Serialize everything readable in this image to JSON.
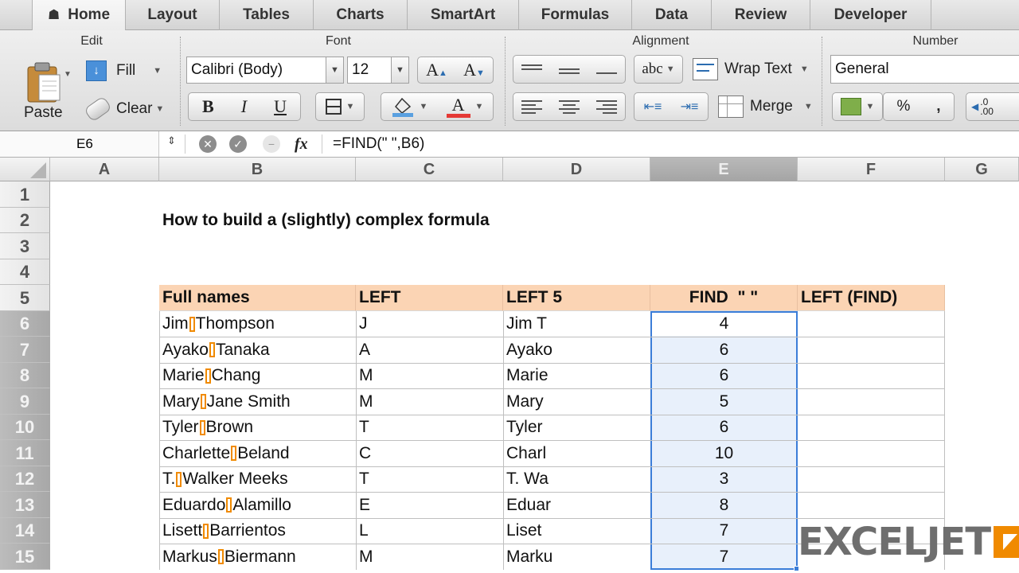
{
  "tabs": [
    {
      "label": "Home",
      "active": true
    },
    {
      "label": "Layout"
    },
    {
      "label": "Tables"
    },
    {
      "label": "Charts"
    },
    {
      "label": "SmartArt"
    },
    {
      "label": "Formulas"
    },
    {
      "label": "Data"
    },
    {
      "label": "Review"
    },
    {
      "label": "Developer"
    }
  ],
  "ribbon": {
    "groups": {
      "edit": "Edit",
      "font": "Font",
      "alignment": "Alignment",
      "number": "Number"
    },
    "paste_label": "Paste",
    "fill_label": "Fill",
    "clear_label": "Clear",
    "font_name": "Calibri (Body)",
    "font_size": "12",
    "bold": "B",
    "italic": "I",
    "underline": "U",
    "grow_font": "A",
    "shrink_font": "A",
    "font_color": "A",
    "abc_label": "abc",
    "wrap_text_label": "Wrap Text",
    "merge_label": "Merge",
    "number_format": "General",
    "percent": "%",
    "comma": ",",
    "decimal": ".0",
    "decimal_2": ".00",
    "font_color_accent": "#e53935"
  },
  "formula_bar": {
    "cell_ref": "E6",
    "formula": "=FIND(\" \",B6)",
    "fx": "fx"
  },
  "sheet": {
    "columns": [
      "A",
      "B",
      "C",
      "D",
      "E",
      "F",
      "G"
    ],
    "rows": [
      "1",
      "2",
      "3",
      "4",
      "5",
      "6",
      "7",
      "8",
      "9",
      "10",
      "11",
      "12",
      "13",
      "14",
      "15"
    ],
    "title": "How to build a (slightly) complex formula",
    "headers": [
      "Full names",
      "LEFT",
      "LEFT 5",
      "FIND  \" \"",
      "LEFT (FIND)"
    ],
    "data": [
      {
        "first": "Jim",
        "rest": "Thompson",
        "left": "J",
        "left5": "Jim T",
        "find": "4"
      },
      {
        "first": "Ayako",
        "rest": "Tanaka",
        "left": "A",
        "left5": "Ayako",
        "find": "6"
      },
      {
        "first": "Marie",
        "rest": "Chang",
        "left": "M",
        "left5": "Marie",
        "find": "6"
      },
      {
        "first": "Mary",
        "rest": "Jane Smith",
        "left": "M",
        "left5": "Mary",
        "find": "5"
      },
      {
        "first": "Tyler",
        "rest": "Brown",
        "left": "T",
        "left5": "Tyler",
        "find": "6"
      },
      {
        "first": "Charlette",
        "rest": "Beland",
        "left": "C",
        "left5": "Charl",
        "find": "10"
      },
      {
        "first": "T.",
        "rest": "Walker Meeks",
        "left": "T",
        "left5": "T. Wa",
        "find": "3"
      },
      {
        "first": "Eduardo",
        "rest": "Alamillo",
        "left": "E",
        "left5": "Eduar",
        "find": "8"
      },
      {
        "first": "Lisett",
        "rest": "Barrientos",
        "left": "L",
        "left5": "Liset",
        "find": "7"
      },
      {
        "first": "Markus",
        "rest": "Biermann",
        "left": "M",
        "left5": "Marku",
        "find": "7"
      }
    ]
  },
  "watermark": "EXCELJET",
  "colors": {
    "header_fill": "#fbd4b4",
    "selection_border": "#3b7dd8",
    "highlight": "#f08a00"
  }
}
